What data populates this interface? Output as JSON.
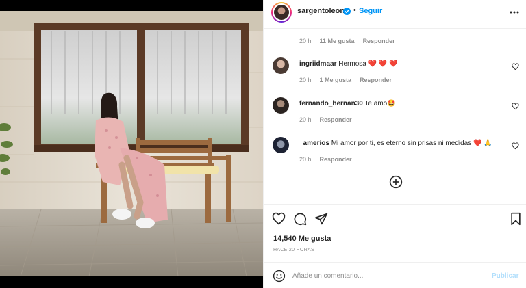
{
  "post": {
    "username": "sargentoleon",
    "follow_label": "Seguir",
    "separator": "•",
    "likes_text": "14,540 Me gusta",
    "time_ago": "HACE 20 HORAS"
  },
  "caption_meta": {
    "time": "20 h",
    "likes": "11 Me gusta",
    "reply": "Responder"
  },
  "comments": [
    {
      "user": "ingriidmaar",
      "text": "Hermosa ❤️ ❤️ ❤️",
      "time": "20 h",
      "likes": "1 Me gusta",
      "reply": "Responder"
    },
    {
      "user": "fernando_hernan30",
      "text": "Te amo🤩",
      "time": "20 h",
      "likes": "",
      "reply": "Responder"
    },
    {
      "user": "_amerios",
      "text": "Mi amor por ti, es eterno sin prisas ni medidas ❤️ 🙏",
      "time": "20 h",
      "likes": "",
      "reply": "Responder"
    }
  ],
  "composer": {
    "placeholder": "Añade un comentario...",
    "post_label": "Publicar"
  },
  "icons": {
    "more": "more-options-icon",
    "like": "heart-icon",
    "comment": "comment-icon",
    "share": "paper-plane-icon",
    "save": "bookmark-icon",
    "emoji": "smiley-icon",
    "load_more": "plus-circle-icon",
    "verified": "verified-badge-icon"
  },
  "colors": {
    "accent": "#0095f6",
    "post_disabled": "#b2dffc",
    "muted": "#8e8e8e",
    "text": "#262626"
  }
}
